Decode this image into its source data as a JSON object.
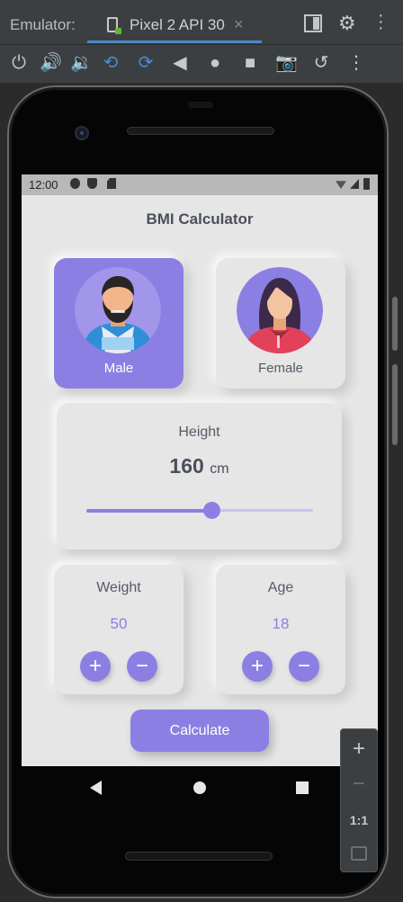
{
  "window": {
    "label": "Emulator:",
    "tab_name": "Pixel 2 API 30",
    "tab_close": "×",
    "icons": [
      "window-mode-icon",
      "gear-icon",
      "more-icon"
    ]
  },
  "toolbar": {
    "icons": [
      "power-icon",
      "volume-up-icon",
      "volume-down-icon",
      "rotate-left-icon",
      "rotate-right-icon",
      "back-icon",
      "home-icon",
      "overview-icon",
      "screenshot-icon",
      "snapshot-icon",
      "more-icon"
    ]
  },
  "status_bar": {
    "time": "12:00"
  },
  "app": {
    "title": "BMI Calculator",
    "accent": "#8c7fe3",
    "background": "#e6e6e6",
    "gender": {
      "male_label": "Male",
      "female_label": "Female",
      "selected": "Male"
    },
    "height": {
      "label": "Height",
      "value": "160",
      "unit": "cm",
      "slider_fraction": 0.55
    },
    "weight": {
      "label": "Weight",
      "value": "50",
      "plus": "+",
      "minus": "−"
    },
    "age": {
      "label": "Age",
      "value": "18",
      "plus": "+",
      "minus": "−"
    },
    "calculate_label": "Calculate"
  },
  "zoom_panel": {
    "plus": "+",
    "minus": "−",
    "one_to_one": "1:1"
  }
}
